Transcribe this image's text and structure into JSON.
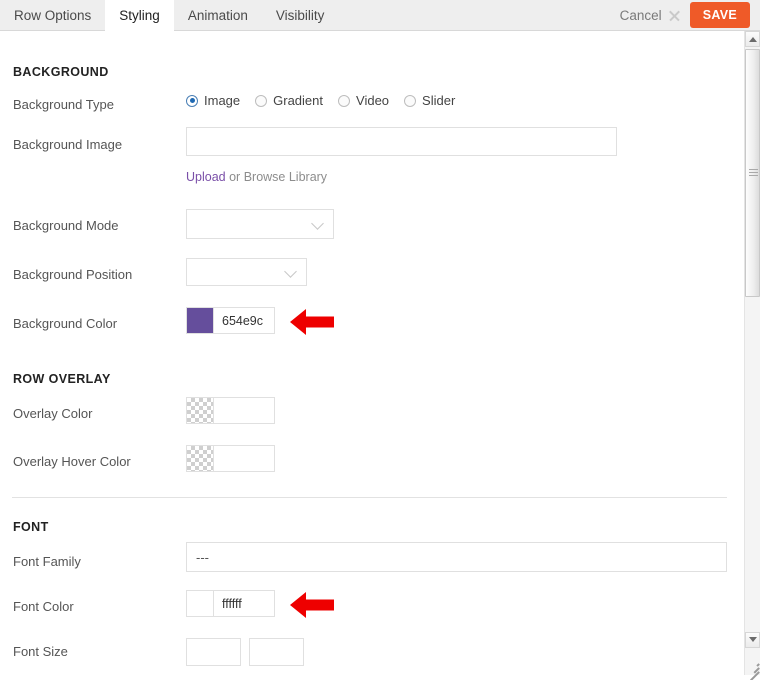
{
  "tabs": [
    {
      "label": "Row Options",
      "active": false
    },
    {
      "label": "Styling",
      "active": true
    },
    {
      "label": "Animation",
      "active": false
    },
    {
      "label": "Visibility",
      "active": false
    }
  ],
  "header": {
    "cancel_label": "Cancel",
    "cancel_icon": "close-icon",
    "save_label": "SAVE",
    "save_color": "#ef5a28"
  },
  "sections": {
    "background": {
      "title": "BACKGROUND",
      "background_type": {
        "label": "Background Type",
        "options": [
          "Image",
          "Gradient",
          "Video",
          "Slider"
        ],
        "selected": "Image"
      },
      "background_image": {
        "label": "Background Image",
        "value": "",
        "placeholder": ""
      },
      "upload": {
        "link_label": "Upload",
        "rest_label": "or Browse Library",
        "link_color": "#7a4fa8"
      },
      "background_mode": {
        "label": "Background Mode",
        "value": "",
        "icon": "chevron-down-icon"
      },
      "background_position": {
        "label": "Background Position",
        "value": "",
        "icon": "chevron-down-icon"
      },
      "background_color": {
        "label": "Background Color",
        "value": "654e9c",
        "swatch_color": "#654e9c",
        "transparent": false
      }
    },
    "row_overlay": {
      "title": "ROW OVERLAY",
      "overlay_color": {
        "label": "Overlay Color",
        "value": "",
        "swatch_color": "",
        "transparent": true
      },
      "overlay_hover_color": {
        "label": "Overlay Hover Color",
        "value": "",
        "swatch_color": "",
        "transparent": true
      }
    },
    "font": {
      "title": "FONT",
      "font_family": {
        "label": "Font Family",
        "value": "---"
      },
      "font_color": {
        "label": "Font Color",
        "value": "ffffff",
        "swatch_color": "#ffffff",
        "transparent": false
      },
      "font_size": {
        "label": "Font Size",
        "value_1": "",
        "value_2": ""
      }
    }
  },
  "annotations": {
    "arrow_color": "#ee0000",
    "arrow_background_color": "points-to-background-color-field",
    "arrow_font_color": "points-to-font-color-field"
  },
  "scrollbar": {
    "up_icon": "scroll-up-arrow-icon",
    "down_icon": "scroll-down-arrow-icon",
    "thumb": "scrollbar-thumb",
    "resize_icon": "resize-grip-icon"
  }
}
